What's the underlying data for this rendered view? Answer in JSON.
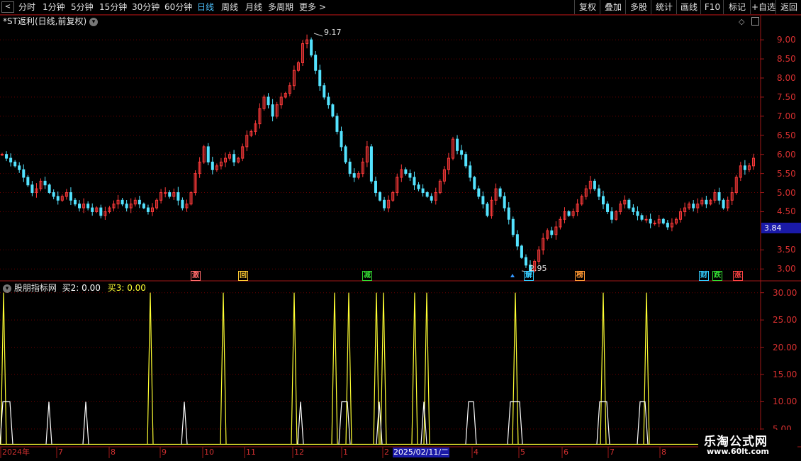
{
  "toolbar": {
    "back_arrow": "<",
    "periods": [
      "分时",
      "1分钟",
      "5分钟",
      "15分钟",
      "30分钟",
      "60分钟",
      "日线",
      "周线",
      "月线",
      "多周期",
      "更多 >"
    ],
    "active_period": "日线",
    "actions": [
      "复权",
      "叠加",
      "多股",
      "统计",
      "画线",
      "F10",
      "标记",
      "+自选",
      "返回"
    ]
  },
  "main_panel": {
    "title": "*ST返利(日线,前复权)",
    "high_label": "9.17",
    "low_label": "2.95",
    "current_price": "3.84",
    "y_ticks": [
      "9.00",
      "8.50",
      "8.00",
      "7.50",
      "7.00",
      "6.50",
      "6.00",
      "5.50",
      "5.00",
      "4.50",
      "3.50",
      "3.00"
    ],
    "signals": [
      {
        "text": "激",
        "color": "#ff6a6a"
      },
      {
        "text": "回",
        "color": "#ffcc33"
      },
      {
        "text": "减",
        "color": "#33dd33"
      },
      {
        "text": "解",
        "color": "#33ccff"
      },
      {
        "text": "榜",
        "color": "#ff9933"
      },
      {
        "text": "财",
        "color": "#33ccff"
      },
      {
        "text": "跌",
        "color": "#33dd33"
      },
      {
        "text": "涨",
        "color": "#ff4444"
      }
    ]
  },
  "indicator_panel": {
    "title": "股朋指标网",
    "buy2_label": "买2: 0.00",
    "buy3_label": "买3: 0.00",
    "y_ticks": [
      "30.00",
      "25.00",
      "20.00",
      "15.00",
      "10.00",
      "5.00"
    ]
  },
  "x_axis": {
    "labels": [
      "2024年",
      "7",
      "8",
      "9",
      "10",
      "11",
      "12",
      "1",
      "2",
      "4",
      "5",
      "6",
      "7",
      "8"
    ],
    "highlight_date": "2025/02/11/二"
  },
  "watermark": {
    "title": "乐淘公式网",
    "url": "www.60lt.com"
  },
  "colors": {
    "up_candle": "#ff3a3a",
    "down_candle": "#54e3ff",
    "grid": "#6a0000",
    "axis": "#a01818",
    "buy2_line": "#ffffff",
    "buy3_line": "#ffff33"
  },
  "chart_data": {
    "type": "candlestick",
    "price_range": [
      2.8,
      9.3
    ],
    "indicator_range": [
      2,
      31
    ],
    "close_series": [
      6.0,
      5.9,
      5.8,
      5.7,
      5.6,
      5.4,
      5.2,
      5.0,
      5.1,
      5.3,
      5.2,
      5.0,
      4.9,
      4.8,
      4.9,
      5.0,
      4.8,
      4.7,
      4.6,
      4.7,
      4.6,
      4.5,
      4.6,
      4.4,
      4.5,
      4.6,
      4.7,
      4.8,
      4.7,
      4.6,
      4.7,
      4.8,
      4.7,
      4.6,
      4.5,
      4.6,
      4.8,
      5.0,
      5.0,
      4.9,
      5.0,
      4.8,
      4.6,
      4.7,
      5.0,
      5.5,
      5.8,
      6.2,
      5.8,
      5.6,
      5.7,
      5.8,
      5.9,
      6.0,
      5.8,
      5.9,
      6.2,
      6.5,
      6.6,
      6.8,
      7.2,
      7.5,
      7.3,
      7.0,
      7.3,
      7.5,
      7.6,
      7.8,
      8.2,
      8.4,
      8.9,
      9.0,
      8.6,
      8.2,
      7.8,
      7.5,
      7.3,
      7.0,
      6.6,
      6.2,
      5.8,
      5.5,
      5.4,
      5.5,
      5.8,
      6.2,
      5.3,
      5.0,
      4.8,
      4.6,
      4.8,
      5.0,
      5.4,
      5.6,
      5.5,
      5.4,
      5.2,
      5.1,
      5.0,
      4.9,
      4.8,
      5.0,
      5.3,
      5.6,
      5.9,
      6.4,
      6.1,
      6.0,
      5.7,
      5.4,
      5.1,
      4.9,
      4.7,
      4.4,
      4.8,
      5.1,
      4.9,
      4.6,
      4.3,
      3.9,
      3.6,
      3.3,
      3.1,
      2.95,
      3.2,
      3.5,
      3.8,
      4.0,
      3.9,
      4.1,
      4.3,
      4.5,
      4.4,
      4.5,
      4.7,
      4.9,
      5.1,
      5.3,
      5.1,
      4.9,
      4.7,
      4.5,
      4.3,
      4.5,
      4.7,
      4.8,
      4.6,
      4.5,
      4.4,
      4.3,
      4.3,
      4.2,
      4.2,
      4.3,
      4.2,
      4.1,
      4.2,
      4.3,
      4.5,
      4.6,
      4.7,
      4.6,
      4.7,
      4.8,
      4.7,
      4.8,
      5.0,
      4.8,
      4.6,
      4.8,
      5.0,
      5.4,
      5.7,
      5.6,
      5.7,
      5.9
    ]
  }
}
